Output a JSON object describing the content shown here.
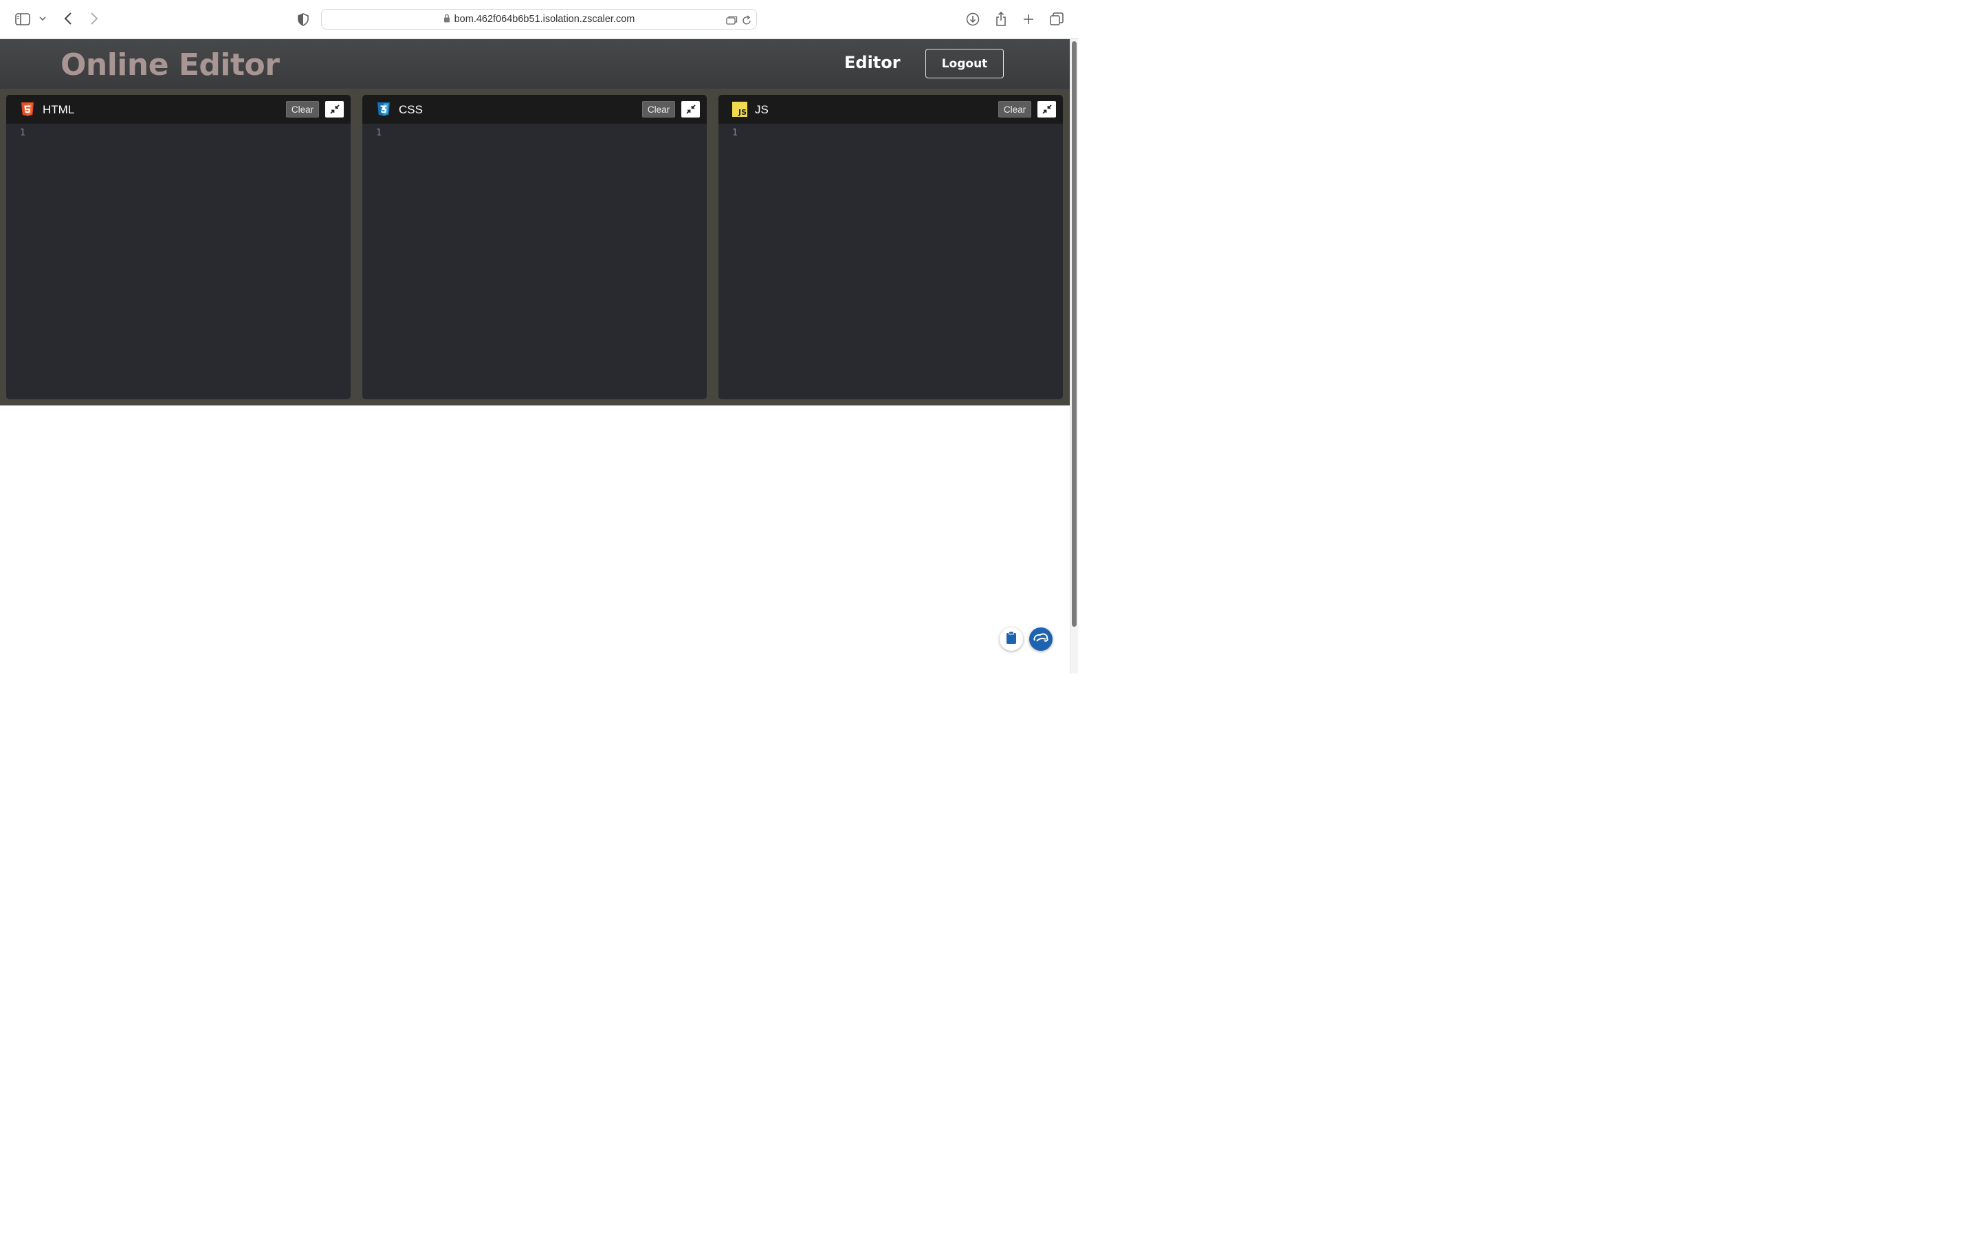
{
  "browser": {
    "url": "bom.462f064b6b51.isolation.zscaler.com"
  },
  "header": {
    "title": "Online Editor",
    "nav_editor": "Editor",
    "logout_label": "Logout"
  },
  "panes": [
    {
      "label": "HTML",
      "icon": "html5-icon",
      "clear_label": "Clear",
      "line_number": "1"
    },
    {
      "label": "CSS",
      "icon": "css3-icon",
      "clear_label": "Clear",
      "line_number": "1"
    },
    {
      "label": "JS",
      "icon": "js-icon",
      "icon_text": "JS",
      "clear_label": "Clear",
      "line_number": "1"
    }
  ],
  "colors": {
    "title": "#a89594",
    "header_bg": "#424345",
    "editor_area_bg": "#48473f",
    "pane_bg": "#282a30",
    "pane_header_bg": "#1a1a1a",
    "html_icon": "#e44d26",
    "css_icon": "#1f6fb8",
    "js_icon": "#f0db4f",
    "widget_blue": "#1e63b0"
  }
}
